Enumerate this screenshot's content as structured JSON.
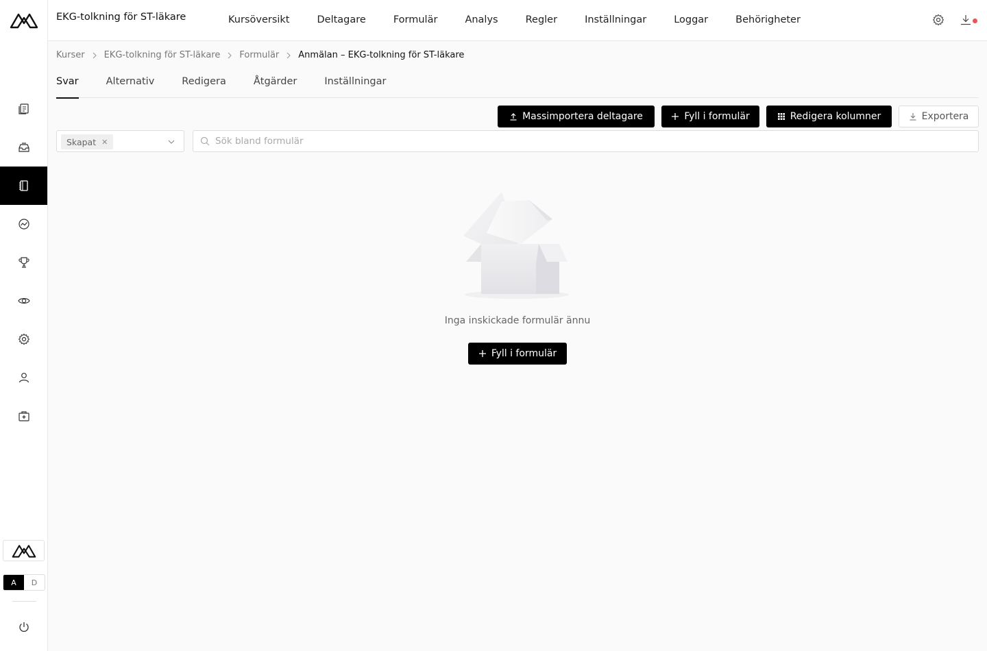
{
  "app": {
    "course_title": "EKG-tolkning för ST-läkare"
  },
  "topnav": {
    "items": [
      "Kursöversikt",
      "Deltagare",
      "Formulär",
      "Analys",
      "Regler",
      "Inställningar",
      "Loggar",
      "Behörigheter"
    ]
  },
  "sidebar": {
    "icons": [
      "courses-icon",
      "inbox-icon",
      "forms-icon",
      "analytics-icon",
      "trophy-icon",
      "eye-icon",
      "gear-icon",
      "user-icon",
      "medical-kit-icon"
    ],
    "active_index": 2,
    "lang": {
      "a": "A",
      "d": "D",
      "selected": "A"
    }
  },
  "breadcrumb": {
    "items": [
      "Kurser",
      "EKG-tolkning för ST-läkare",
      "Formulär"
    ],
    "current": "Anmälan – EKG-tolkning för ST-läkare"
  },
  "tabs": {
    "items": [
      "Svar",
      "Alternativ",
      "Redigera",
      "Åtgärder",
      "Inställningar"
    ],
    "active": "Svar"
  },
  "actions": {
    "bulk_import": "Massimportera deltagare",
    "fill_form": "Fyll i formulär",
    "edit_columns": "Redigera kolumner",
    "export": "Exportera"
  },
  "filter": {
    "chip_label": "Skapat"
  },
  "search": {
    "placeholder": "Sök bland formulär",
    "value": ""
  },
  "empty_state": {
    "message": "Inga inskickade formulär ännu",
    "button_label": "Fyll i formulär"
  },
  "colors": {
    "accent": "#000000",
    "notification_dot": "#f05252",
    "background": "#fafafa"
  }
}
